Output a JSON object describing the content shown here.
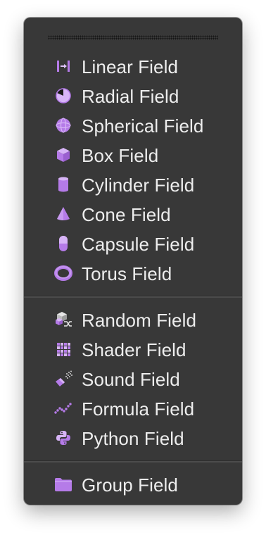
{
  "menu": {
    "group_primitives": [
      {
        "label": "Linear Field",
        "icon": "linear-field-icon"
      },
      {
        "label": "Radial Field",
        "icon": "radial-field-icon"
      },
      {
        "label": "Spherical Field",
        "icon": "spherical-field-icon"
      },
      {
        "label": "Box Field",
        "icon": "box-field-icon"
      },
      {
        "label": "Cylinder Field",
        "icon": "cylinder-field-icon"
      },
      {
        "label": "Cone Field",
        "icon": "cone-field-icon"
      },
      {
        "label": "Capsule Field",
        "icon": "capsule-field-icon"
      },
      {
        "label": "Torus Field",
        "icon": "torus-field-icon"
      }
    ],
    "group_procedural": [
      {
        "label": "Random Field",
        "icon": "random-field-icon"
      },
      {
        "label": "Shader Field",
        "icon": "shader-field-icon"
      },
      {
        "label": "Sound Field",
        "icon": "sound-field-icon"
      },
      {
        "label": "Formula Field",
        "icon": "formula-field-icon"
      },
      {
        "label": "Python Field",
        "icon": "python-field-icon"
      }
    ],
    "group_other": [
      {
        "label": "Group Field",
        "icon": "group-field-folder-icon"
      }
    ]
  },
  "colors": {
    "menu_background": "#383838",
    "text": "#ededed",
    "icon_accent": "#b57be8",
    "icon_highlight": "#d7b4f7",
    "separator": "#4c4c4c"
  }
}
